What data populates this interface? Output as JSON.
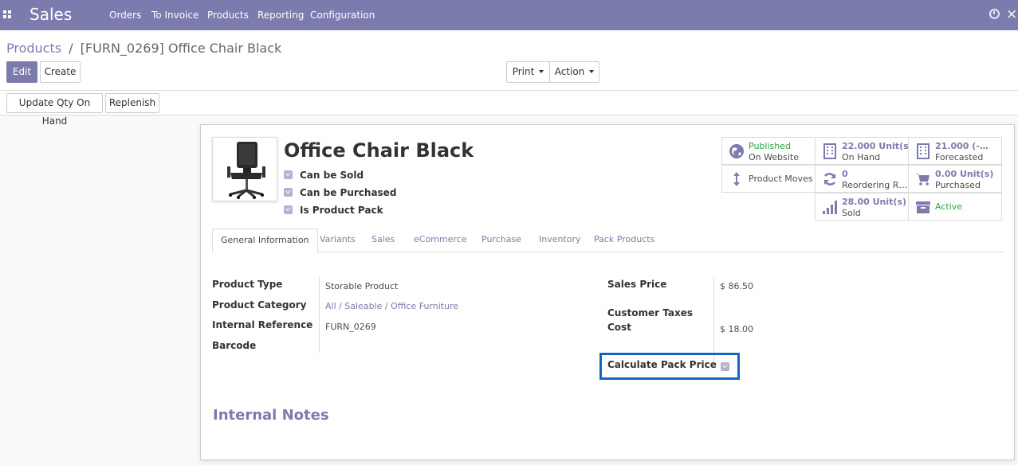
{
  "navbar": {
    "app_name": "Sales",
    "menu": [
      "Orders",
      "To Invoice",
      "Products",
      "Reporting",
      "Configuration"
    ]
  },
  "breadcrumb": {
    "parent": "Products",
    "separator": "/",
    "current": "[FURN_0269] Office Chair Black"
  },
  "buttons": {
    "edit": "Edit",
    "create": "Create",
    "print": "Print",
    "action": "Action",
    "update_qty": "Update Qty On Hand",
    "replenish": "Replenish"
  },
  "product": {
    "name": "Office Chair Black",
    "checkboxes": [
      "Can be Sold",
      "Can be Purchased",
      "Is Product Pack"
    ]
  },
  "smart_buttons": [
    {
      "value": "Published",
      "label": "On Website",
      "icon": "globe-icon"
    },
    {
      "value": "22.000 Unit(s)",
      "label": "On Hand",
      "icon": "building-icon"
    },
    {
      "value": "21.000 (-…",
      "label": "Forecasted",
      "icon": "building-icon"
    },
    {
      "value": "",
      "label": "Product Moves",
      "icon": "arrows-v-icon"
    },
    {
      "value": "0",
      "label": "Reordering R…",
      "icon": "refresh-icon"
    },
    {
      "value": "0.00 Unit(s)",
      "label": "Purchased",
      "icon": "cart-icon"
    },
    {
      "value": "28.00 Unit(s)",
      "label": "Sold",
      "icon": "signal-icon"
    },
    {
      "value": "Active",
      "label": "",
      "icon": "archive-icon"
    }
  ],
  "tabs": [
    "General Information",
    "Variants",
    "Sales",
    "eCommerce",
    "Purchase",
    "Inventory",
    "Pack Products"
  ],
  "fields_left": [
    {
      "label": "Product Type",
      "value": "Storable Product"
    },
    {
      "label": "Product Category",
      "value": "All / Saleable / Office Furniture"
    },
    {
      "label": "Internal Reference",
      "value": "FURN_0269"
    },
    {
      "label": "Barcode",
      "value": ""
    }
  ],
  "fields_right": [
    {
      "label": "Sales Price",
      "value": "$ 86.50"
    },
    {
      "label": "Customer Taxes",
      "value": ""
    },
    {
      "label": "Cost",
      "value": "$ 18.00"
    },
    {
      "label": "Calculate Pack Price",
      "value": ""
    }
  ],
  "notes_title": "Internal Notes",
  "colors": {
    "brand": "#7c7bad",
    "published": "#28a745",
    "highlight": "#1565c0"
  }
}
